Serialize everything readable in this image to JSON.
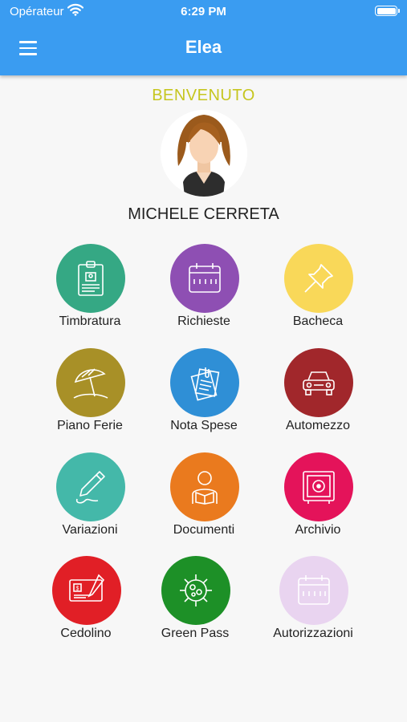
{
  "status_bar": {
    "carrier": "Opérateur",
    "time": "6:29 PM"
  },
  "header": {
    "title": "Elea"
  },
  "welcome": {
    "text": "BENVENUTO"
  },
  "user": {
    "name": "MICHELE CERRETA"
  },
  "tiles": [
    {
      "label": "Timbratura",
      "icon": "badge-icon",
      "color": "#35a884"
    },
    {
      "label": "Richieste",
      "icon": "calendar-icon",
      "color": "#8e4fb3"
    },
    {
      "label": "Bacheca",
      "icon": "pushpin-icon",
      "color": "#f9d859"
    },
    {
      "label": "Piano Ferie",
      "icon": "beach-umbrella-icon",
      "color": "#a89027"
    },
    {
      "label": "Nota Spese",
      "icon": "receipt-clip-icon",
      "color": "#2f8fd6"
    },
    {
      "label": "Automezzo",
      "icon": "car-icon",
      "color": "#a1272b"
    },
    {
      "label": "Variazioni",
      "icon": "pencil-icon",
      "color": "#44b8a9"
    },
    {
      "label": "Documenti",
      "icon": "reader-icon",
      "color": "#ea7a1e"
    },
    {
      "label": "Archivio",
      "icon": "safe-icon",
      "color": "#e4135a"
    },
    {
      "label": "Cedolino",
      "icon": "cheque-icon",
      "color": "#e11f26"
    },
    {
      "label": "Green Pass",
      "icon": "virus-icon",
      "color": "#1d9027"
    },
    {
      "label": "Autorizzazioni",
      "icon": "calendar-icon",
      "color": "#e9d4f0"
    }
  ]
}
